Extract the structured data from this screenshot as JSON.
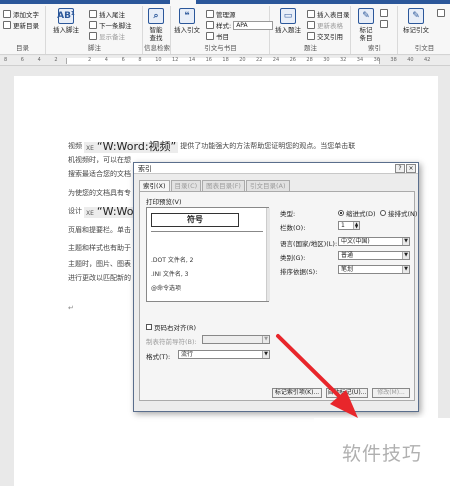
{
  "ribbon": {
    "groups": {
      "toc": {
        "label": "目录",
        "add_text": "添加文字",
        "update_toc": "更新目录"
      },
      "footnote": {
        "label": "脚注",
        "insert_footnote": "插入脚注",
        "insert_endnote": "插入尾注",
        "next_footnote": "下一条脚注",
        "show_notes": "显示备注",
        "ab_glyph": "AB¹"
      },
      "research": {
        "label": "信息检索",
        "smart_lookup": "智能\n查找"
      },
      "citations": {
        "label": "引文与书目",
        "insert_citation": "插入引文",
        "manage_sources": "管理源",
        "style_label": "样式:",
        "style_value": "APA",
        "bibliography": "书目"
      },
      "captions": {
        "label": "题注",
        "insert_caption": "插入题注",
        "insert_table_of_figures": "插入表目录",
        "update_table": "更新表格",
        "cross_reference": "交叉引用"
      },
      "index": {
        "label": "索引",
        "mark_entry": "标记\n条目"
      },
      "toa": {
        "label": "引文目",
        "mark_citation": "标记引文"
      }
    }
  },
  "ruler": {
    "ticks": [
      "8",
      "6",
      "4",
      "2",
      "",
      "2",
      "4",
      "6",
      "8",
      "10",
      "12",
      "14",
      "16",
      "18",
      "20",
      "22",
      "24",
      "26",
      "28",
      "30",
      "32",
      "34",
      "36",
      "38",
      "40",
      "42"
    ]
  },
  "document": {
    "lines": [
      {
        "pre": "视频",
        "field_code": "XE",
        "field_text": "“W:Word:视频”",
        "post": "提供了功能强大的方法帮助您证明您的观点。当您单击联"
      },
      {
        "pre": "机视频时，可以在想",
        "field_code": "",
        "field_text": "",
        "post": ""
      },
      {
        "pre": "搜索最适合您的文档",
        "field_code": "",
        "field_text": "",
        "post": ""
      },
      {
        "pre": "为使您的文档具有专",
        "field_code": "",
        "field_text": "",
        "post": ""
      },
      {
        "pre": "设计",
        "field_code": "XE",
        "field_text": "“W:Word",
        "post": ""
      },
      {
        "pre": "页眉和提要栏。单击",
        "field_code": "",
        "field_text": "",
        "post": ""
      },
      {
        "pre": "主题和样式也有助于",
        "field_code": "",
        "field_text": "",
        "post": ""
      },
      {
        "pre": "主题时，图片、图表",
        "field_code": "",
        "field_text": "",
        "post": ""
      },
      {
        "pre": "进行更改以匹配新的",
        "field_code": "",
        "field_text": "",
        "post": ""
      }
    ]
  },
  "dialog": {
    "title": "索引",
    "help": "?",
    "close": "×",
    "tabs": [
      "索引(X)",
      "目录(C)",
      "图表目录(F)",
      "引文目录(A)"
    ],
    "print_preview_label": "打印预览(V)",
    "preview": {
      "heading": "符号",
      "items": [
        ".DOT 文件名, 2",
        ".INI 文件名, 3",
        "@命令选项"
      ]
    },
    "type_label": "类型:",
    "type_options": [
      "缩进式(D)",
      "接排式(N)"
    ],
    "columns_label": "栏数(O):",
    "columns_value": "1",
    "language_label": "语言(国家/地区)(L):",
    "language_value": "中文(中国)",
    "category_label": "类别(G):",
    "category_value": "普通",
    "sort_label": "排序依据(S):",
    "sort_value": "笔划",
    "right_align_label": "页码右对齐(R)",
    "tab_leader_label": "制表符前导符(B):",
    "formats_label": "格式(T):",
    "formats_value": "流行",
    "buttons": {
      "mark_entry": "标记索引项(K)...",
      "auto_mark": "自动标记(U)...",
      "modify": "修改(M)..."
    }
  },
  "watermark": "软件技巧",
  "colors": {
    "ribbon_accent": "#2b579a",
    "arrow": "#e8262b",
    "dialog_border": "#5a6e8c"
  }
}
